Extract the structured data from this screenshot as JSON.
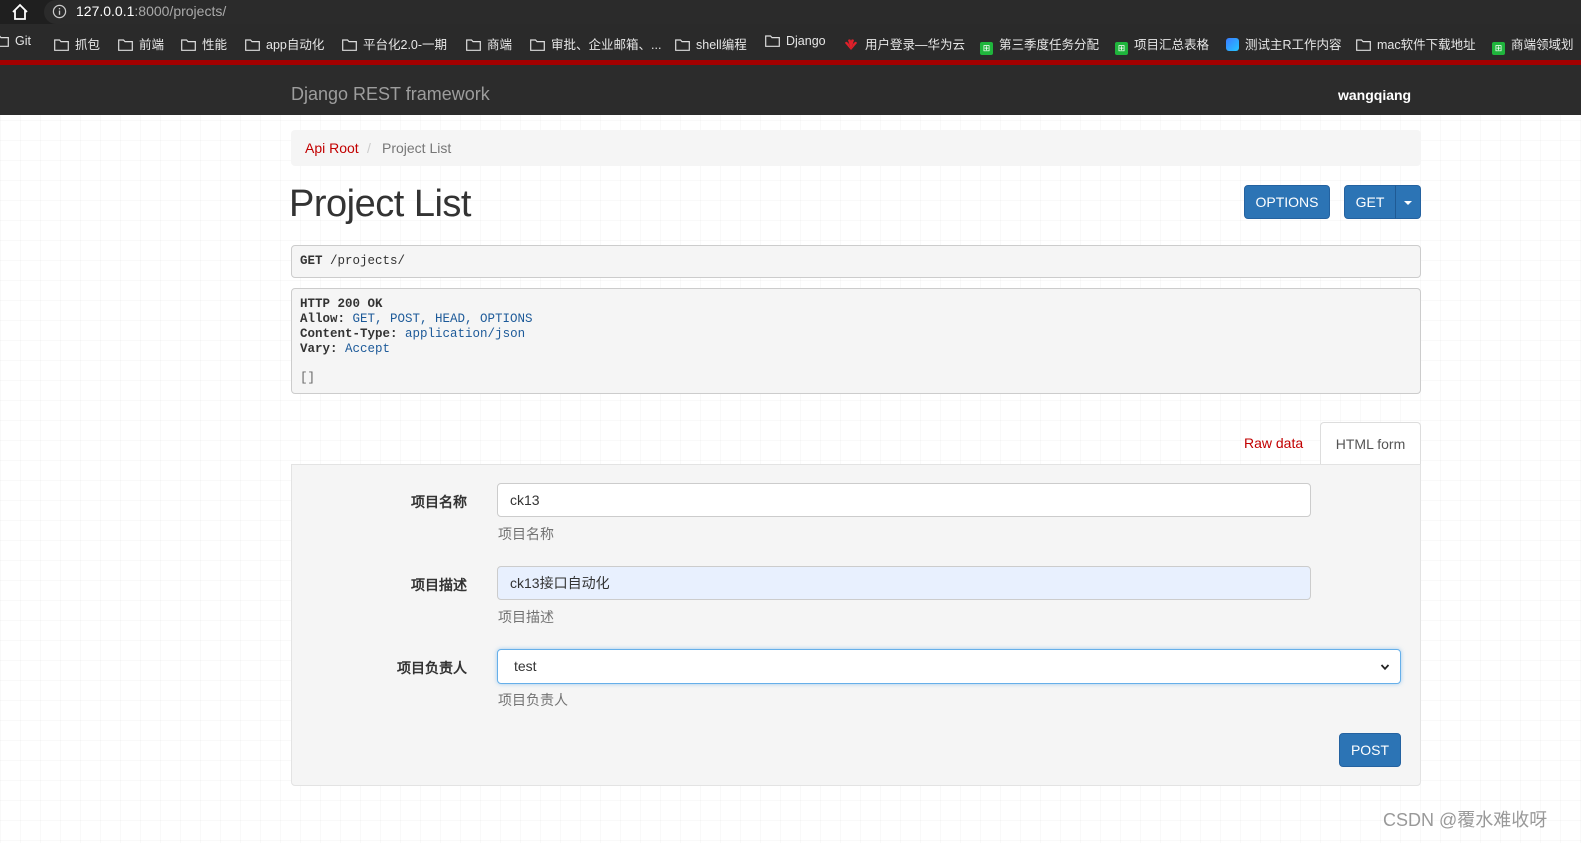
{
  "browser": {
    "url_host": "127.0.0.1",
    "url_rest": ":8000/projects/",
    "bookmarks": [
      {
        "label": "Git",
        "icon": "folder-icon"
      },
      {
        "label": "抓包",
        "icon": "folder-icon"
      },
      {
        "label": "前端",
        "icon": "folder-icon"
      },
      {
        "label": "性能",
        "icon": "folder-icon"
      },
      {
        "label": "app自动化",
        "icon": "folder-icon"
      },
      {
        "label": "平台化2.0-一期",
        "icon": "folder-icon"
      },
      {
        "label": "商端",
        "icon": "folder-icon"
      },
      {
        "label": "审批、企业邮箱、...",
        "icon": "folder-icon"
      },
      {
        "label": "shell编程",
        "icon": "folder-icon"
      },
      {
        "label": "Django",
        "icon": "folder-icon"
      },
      {
        "label": "用户登录—华为云",
        "icon": "huawei-icon"
      },
      {
        "label": "第三季度任务分配",
        "icon": "sheet-icon"
      },
      {
        "label": "项目汇总表格",
        "icon": "sheet-icon"
      },
      {
        "label": "测试主R工作内容",
        "icon": "doc-icon"
      },
      {
        "label": "mac软件下载地址",
        "icon": "folder-icon"
      },
      {
        "label": "商端领域划",
        "icon": "sheet-icon"
      }
    ]
  },
  "navbar": {
    "brand": "Django REST framework",
    "user": "wangqiang"
  },
  "breadcrumb": {
    "root": "Api Root",
    "separator": "/",
    "current": "Project List"
  },
  "page": {
    "title": "Project List",
    "options_label": "OPTIONS",
    "get_label": "GET"
  },
  "request": {
    "method": "GET",
    "path": "/projects/"
  },
  "response": {
    "status": "HTTP 200 OK",
    "headers": [
      {
        "name": "Allow:",
        "value": "GET, POST, HEAD, OPTIONS"
      },
      {
        "name": "Content-Type:",
        "value": "application/json"
      },
      {
        "name": "Vary:",
        "value": "Accept"
      }
    ],
    "body": "[]"
  },
  "tabs": {
    "raw": "Raw data",
    "html": "HTML form"
  },
  "form": {
    "name": {
      "label": "项目名称",
      "value": "ck13",
      "help": "项目名称"
    },
    "desc": {
      "label": "项目描述",
      "value": "ck13接口自动化",
      "help": "项目描述"
    },
    "leader": {
      "label": "项目负责人",
      "value": "test",
      "help": "项目负责人"
    },
    "submit": "POST"
  },
  "watermark": "CSDN @覆水难收呀",
  "colors": {
    "accent": "#2c74b5",
    "navbar": "#2c2c2c",
    "navbar_border": "#a30000",
    "link": "#c20000"
  }
}
